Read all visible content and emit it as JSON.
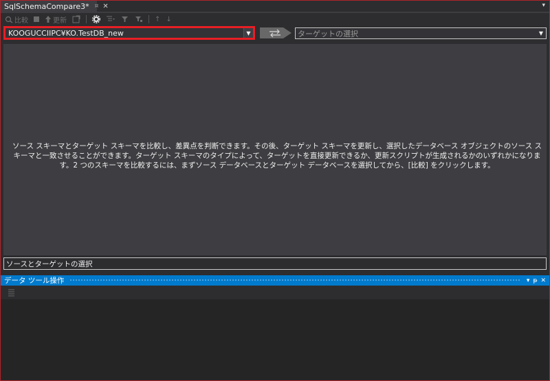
{
  "tab": {
    "title": "SqlSchemaCompare3*",
    "pin": "¤",
    "close": "✕",
    "overflow": "▾"
  },
  "toolbar": {
    "compare_label": "比較",
    "update_label": "更新",
    "filter_glyph": "⊤",
    "up_glyph": "↑",
    "down_glyph": "↓"
  },
  "source": {
    "value": "KOOGUCCIIPC¥KO.TestDB_new",
    "arrow": "▼"
  },
  "target": {
    "placeholder": "ターゲットの選択",
    "arrow": "▼"
  },
  "description": "ソース スキーマとターゲット スキーマを比較し、差異点を判断できます。その後、ターゲット スキーマを更新し、選択したデータベース オブジェクトのソース スキーマと一致させることができます。ターゲット スキーマのタイプによって、ターゲットを直接更新できるか、更新スクリプトが生成されるかのいずれかになります。2 つのスキーマを比較するには、まずソース データベースとターゲット データベースを選択してから、[比較] をクリックします。",
  "hint": "ソースとターゲットの選択",
  "tool_window": {
    "title": "データ ツール操作",
    "dropdown": "▾",
    "pin": "ᵽ",
    "close": "✕"
  },
  "colors": {
    "accent": "#007acc",
    "highlight": "#e81e25",
    "frame": "#b1242a"
  }
}
